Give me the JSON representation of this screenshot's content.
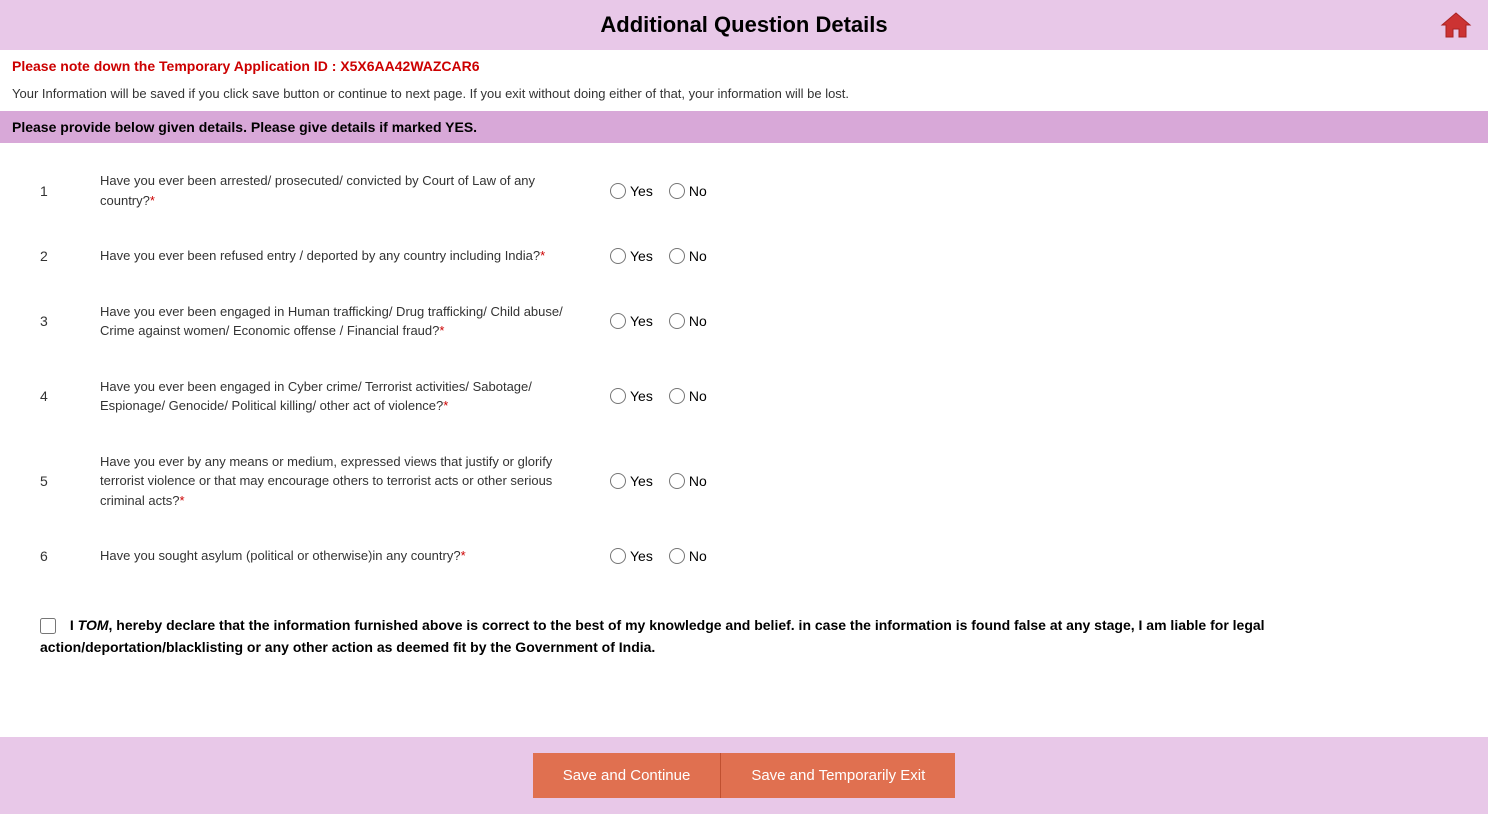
{
  "header": {
    "title": "Additional Question Details",
    "home_icon_label": "Home"
  },
  "app_id": {
    "label": "Please note down the Temporary Application ID :",
    "value": "X5X6AA42WAZCAR6"
  },
  "info_text": "Your Information will be saved if you click save button or continue to next page. If you exit without doing either of that, your information will be lost.",
  "section_header": "Please provide below given details. Please give details if marked YES.",
  "questions": [
    {
      "number": "1",
      "text": "Have you ever been arrested/ prosecuted/ convicted by Court of Law of any country?",
      "required": true
    },
    {
      "number": "2",
      "text": "Have you ever been refused entry / deported by any country including India?",
      "required": true
    },
    {
      "number": "3",
      "text": "Have you ever been engaged in Human trafficking/ Drug trafficking/ Child abuse/ Crime against women/ Economic offense / Financial fraud?",
      "required": true
    },
    {
      "number": "4",
      "text": "Have you ever been engaged in Cyber crime/ Terrorist activities/ Sabotage/ Espionage/ Genocide/ Political killing/ other act of violence?",
      "required": true
    },
    {
      "number": "5",
      "text": "Have you ever by any means or medium, expressed views that justify or glorify terrorist violence or that may encourage others to terrorist acts or other serious criminal acts?",
      "required": true
    },
    {
      "number": "6",
      "text": "Have you sought asylum (political or otherwise)in any country?",
      "required": true
    }
  ],
  "radio_labels": {
    "yes": "Yes",
    "no": "No"
  },
  "declaration": {
    "name": "TOM",
    "text_before": "I ",
    "text_after": ", hereby declare that the information furnished above is correct to the best of my knowledge and belief. in case the information is found false at any stage, I am liable for legal action/deportation/blacklisting or any other action as deemed fit by the Government of India."
  },
  "buttons": {
    "save_continue": "Save and Continue",
    "save_exit": "Save and Temporarily Exit"
  }
}
